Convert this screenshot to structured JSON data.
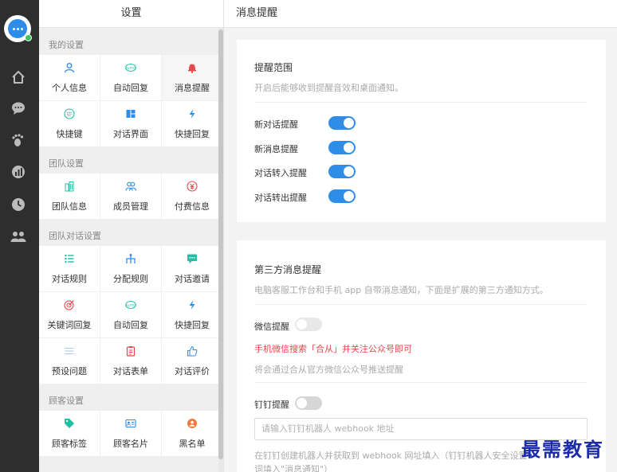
{
  "panel": {
    "title": "设置"
  },
  "groups": [
    {
      "title": "我的设置",
      "items": [
        {
          "label": "个人信息",
          "icon": "user-icon",
          "color": "#2f8dea"
        },
        {
          "label": "自动回复",
          "icon": "auto-icon",
          "color": "#1fc0a5"
        },
        {
          "label": "消息提醒",
          "icon": "bell-icon",
          "color": "#e8474b"
        },
        {
          "label": "快捷键",
          "icon": "keyboard-icon",
          "color": "#1fc0a5"
        },
        {
          "label": "对话界面",
          "icon": "layout-icon",
          "color": "#2f8dea"
        },
        {
          "label": "快捷回复",
          "icon": "lightning-icon",
          "color": "#2f8dea"
        }
      ]
    },
    {
      "title": "团队设置",
      "items": [
        {
          "label": "团队信息",
          "icon": "building-icon",
          "color": "#1fc0a5"
        },
        {
          "label": "成员管理",
          "icon": "users-icon",
          "color": "#2f8dea"
        },
        {
          "label": "付费信息",
          "icon": "yuan-icon",
          "color": "#e8474b"
        }
      ]
    },
    {
      "title": "团队对话设置",
      "items": [
        {
          "label": "对话规则",
          "icon": "rules-icon",
          "color": "#1fc0a5"
        },
        {
          "label": "分配规则",
          "icon": "distribute-icon",
          "color": "#2f8dea"
        },
        {
          "label": "对话邀请",
          "icon": "chat-invite-icon",
          "color": "#1fc0a5"
        },
        {
          "label": "关键词回复",
          "icon": "target-icon",
          "color": "#e8474b"
        },
        {
          "label": "自动回复",
          "icon": "auto-icon",
          "color": "#1fc0a5"
        },
        {
          "label": "快捷回复",
          "icon": "lightning-icon",
          "color": "#2f8dea"
        },
        {
          "label": "预设问题",
          "icon": "list-icon",
          "color": "#a9c7ea"
        },
        {
          "label": "对话表单",
          "icon": "clipboard-icon",
          "color": "#e8474b"
        },
        {
          "label": "对话评价",
          "icon": "thumbs-up-icon",
          "color": "#2f8dea"
        }
      ]
    },
    {
      "title": "顾客设置",
      "items": [
        {
          "label": "顾客标签",
          "icon": "tag-icon",
          "color": "#1fc0a5"
        },
        {
          "label": "顾客名片",
          "icon": "card-icon",
          "color": "#2f8dea"
        },
        {
          "label": "黑名单",
          "icon": "block-user-icon",
          "color": "#f07b3f"
        }
      ]
    }
  ],
  "main": {
    "title": "消息提醒",
    "scope": {
      "title": "提醒范围",
      "desc": "开启后能够收到提醒音效和桌面通知。",
      "toggles": [
        {
          "label": "新对话提醒",
          "on": true
        },
        {
          "label": "新消息提醒",
          "on": true
        },
        {
          "label": "对话转入提醒",
          "on": true
        },
        {
          "label": "对话转出提醒",
          "on": true
        }
      ]
    },
    "third": {
      "title": "第三方消息提醒",
      "desc": "电脑客服工作台和手机 app 自带消息通知，下面是扩展的第三方通知方式。",
      "wechat_label": "微信提醒",
      "wechat_hint": "手机微信搜索「合从」并关注公众号即可",
      "wechat_note": "将会通过合从官方微信公众号推送提醒",
      "dingtalk_label": "钉钉提醒",
      "dingtalk_placeholder": "请输入钉钉机器人 webhook 地址",
      "dingtalk_note_1": "在钉钉创建机器人并获取到 webhook 网址填入（钉钉机器人安全设置",
      "dingtalk_note_2": "词填入\"消息通知\"）"
    }
  },
  "watermark": "最需教育",
  "colors": {
    "accent": "#2f8dea",
    "teal": "#1fc0a5",
    "red": "#e8474b",
    "rail": "#2e2e2e"
  }
}
